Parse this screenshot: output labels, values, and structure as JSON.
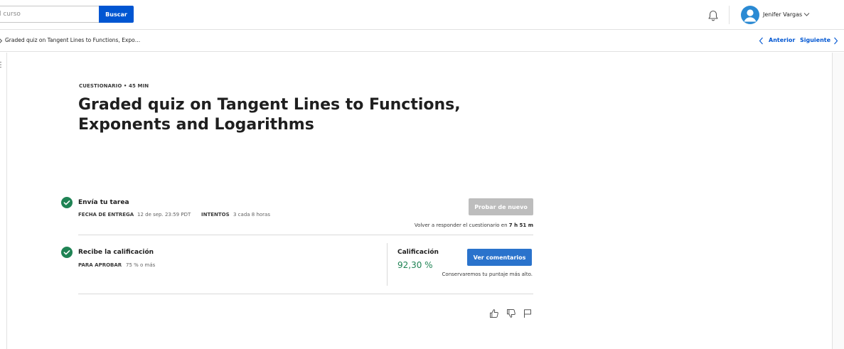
{
  "header": {
    "search": {
      "placeholder": "l curso",
      "button_label": "Buscar"
    },
    "user": {
      "name": "Jenifer Vargas"
    }
  },
  "breadcrumb": {
    "item": "Graded quiz on Tangent Lines to Functions, Expo…",
    "prev_label": "Anterior",
    "next_label": "Siguiente"
  },
  "quiz": {
    "meta": "CUESTIONARIO • 45 MIN",
    "title": "Graded quiz on Tangent Lines to Functions, Exponents and Logarithms"
  },
  "submit_step": {
    "title": "Envía tu tarea",
    "due_label": "FECHA DE ENTREGA",
    "due_value": "12 de sep. 23:59 PDT",
    "attempts_label": "INTENTOS",
    "attempts_value": "3 cada 8 horas",
    "retry_button": "Probar de nuevo",
    "retry_note_prefix": "Volver a responder el cuestionario en",
    "retry_note_time": "7 h 51 m"
  },
  "grade_step": {
    "title": "Recibe la calificación",
    "pass_label": "PARA APROBAR",
    "pass_value": "75 % o más",
    "grade_label": "Calificación",
    "grade_value": "92,30 %",
    "feedback_button": "Ver comentarios",
    "keep_note": "Conservaremos tu puntaje más alto."
  },
  "colors": {
    "accent": "#0056d2",
    "success": "#1f8354",
    "disabled": "#bdbdbd",
    "feedback_button": "#2a73cc"
  },
  "icons": [
    "bell-icon",
    "avatar-icon",
    "chevron-down-icon",
    "chevron-left-icon",
    "chevron-right-icon",
    "check-circle-icon",
    "thumbs-up-icon",
    "thumbs-down-icon",
    "flag-icon"
  ]
}
